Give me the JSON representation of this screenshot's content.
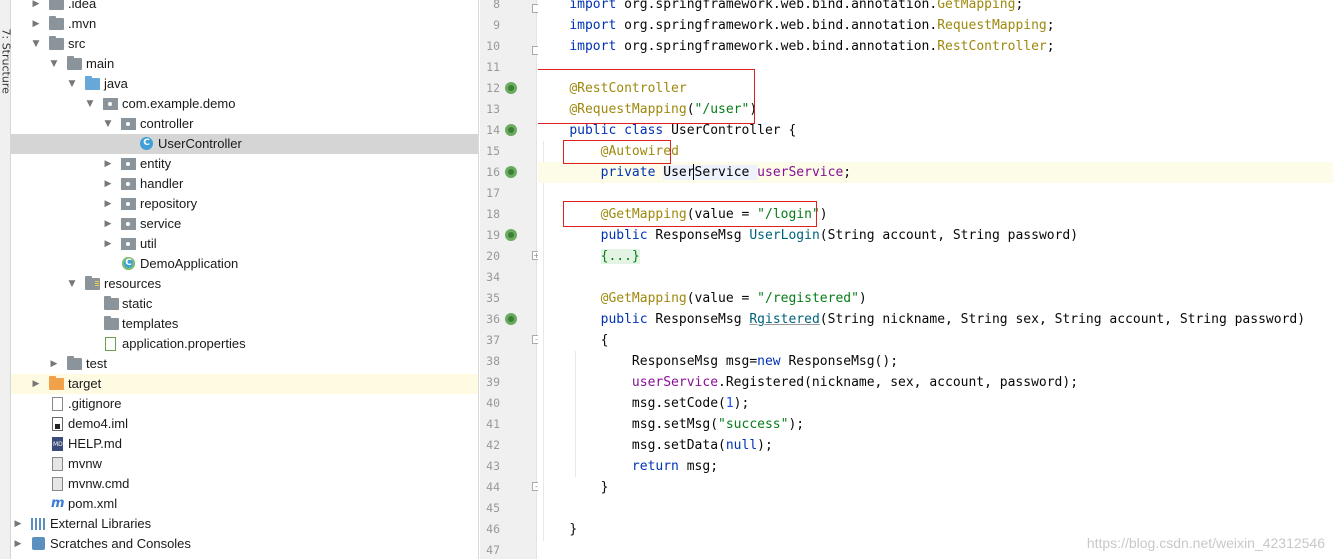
{
  "toolstrip": {
    "structure_label": "7: Structure"
  },
  "tree": {
    "items": [
      {
        "label": ".idea"
      },
      {
        "label": ".mvn"
      },
      {
        "label": "src"
      },
      {
        "label": "main"
      },
      {
        "label": "java"
      },
      {
        "label": "com.example.demo"
      },
      {
        "label": "controller"
      },
      {
        "label": "UserController"
      },
      {
        "label": "entity"
      },
      {
        "label": "handler"
      },
      {
        "label": "repository"
      },
      {
        "label": "service"
      },
      {
        "label": "util"
      },
      {
        "label": "DemoApplication"
      },
      {
        "label": "resources"
      },
      {
        "label": "static"
      },
      {
        "label": "templates"
      },
      {
        "label": "application.properties"
      },
      {
        "label": "test"
      },
      {
        "label": "target"
      },
      {
        "label": ".gitignore"
      },
      {
        "label": "demo4.iml"
      },
      {
        "label": "HELP.md"
      },
      {
        "label": "mvnw"
      },
      {
        "label": "mvnw.cmd"
      },
      {
        "label": "pom.xml"
      },
      {
        "label": "External Libraries"
      },
      {
        "label": "Scratches and Consoles"
      }
    ]
  },
  "gutter": {
    "line_numbers": [
      "8",
      "9",
      "10",
      "11",
      "12",
      "13",
      "14",
      "15",
      "16",
      "17",
      "18",
      "19",
      "20",
      "34",
      "35",
      "36",
      "37",
      "38",
      "39",
      "40",
      "41",
      "42",
      "43",
      "44",
      "45",
      "46",
      "47"
    ]
  },
  "code": {
    "l8_import": "import ",
    "l8_pkg": "org.springframework.web.bind.annotation.",
    "l8_cls": "GetMapping",
    "l8_semi": ";",
    "l9_import": "import ",
    "l9_pkg": "org.springframework.web.bind.annotation.",
    "l9_cls": "RequestMapping",
    "l9_semi": ";",
    "l10_import": "import ",
    "l10_pkg": "org.springframework.web.bind.annotation.",
    "l10_cls": "RestController",
    "l10_semi": ";",
    "l12_ann": "@RestController",
    "l13_ann": "@RequestMapping",
    "l13_open": "(",
    "l13_str": "\"/user\"",
    "l13_close": ")",
    "l14_kw": "public class ",
    "l14_name": "UserController {",
    "l15_ann": "@Autowired",
    "l16_kw": "private ",
    "l16_type": "UserService ",
    "l16_fld": "userService",
    "l16_semi": ";",
    "l18_ann": "@GetMapping",
    "l18_rest": "(value = ",
    "l18_str": "\"/login\"",
    "l18_close": ")",
    "l19_kw": "public ",
    "l19_type": "ResponseMsg ",
    "l19_method": "UserLogin",
    "l19_params": "(String account, String password)",
    "l20_fold": "{...}",
    "l35_ann": "@GetMapping",
    "l35_rest": "(value = ",
    "l35_str": "\"/registered\"",
    "l35_close": ")",
    "l36_kw": "public ",
    "l36_type": "ResponseMsg ",
    "l36_method": "Rgistered",
    "l36_params": "(String nickname, String sex, String account, String password)",
    "l37_brace": "{",
    "l38_type": "ResponseMsg msg=",
    "l38_kw": "new ",
    "l38_rest": "ResponseMsg();",
    "l39_fld": "userService",
    "l39_rest": ".Registered(nickname, sex, account, password);",
    "l40_pre": "msg.setCode(",
    "l40_num": "1",
    "l40_post": ");",
    "l41_pre": "msg.setMsg(",
    "l41_str": "\"success\"",
    "l41_post": ");",
    "l42_pre": "msg.setData(",
    "l42_kw": "null",
    "l42_post": ");",
    "l43_kw": "return ",
    "l43_rest": "msg;",
    "l44_brace": "}",
    "l46_brace": "}"
  },
  "watermark": "https://blog.csdn.net/weixin_42312546",
  "colors": {
    "highlight_box": "#e02020",
    "selection": "#d5d5d5",
    "keyword": "#0033b3",
    "annotation": "#9e880d",
    "string": "#067d17"
  }
}
